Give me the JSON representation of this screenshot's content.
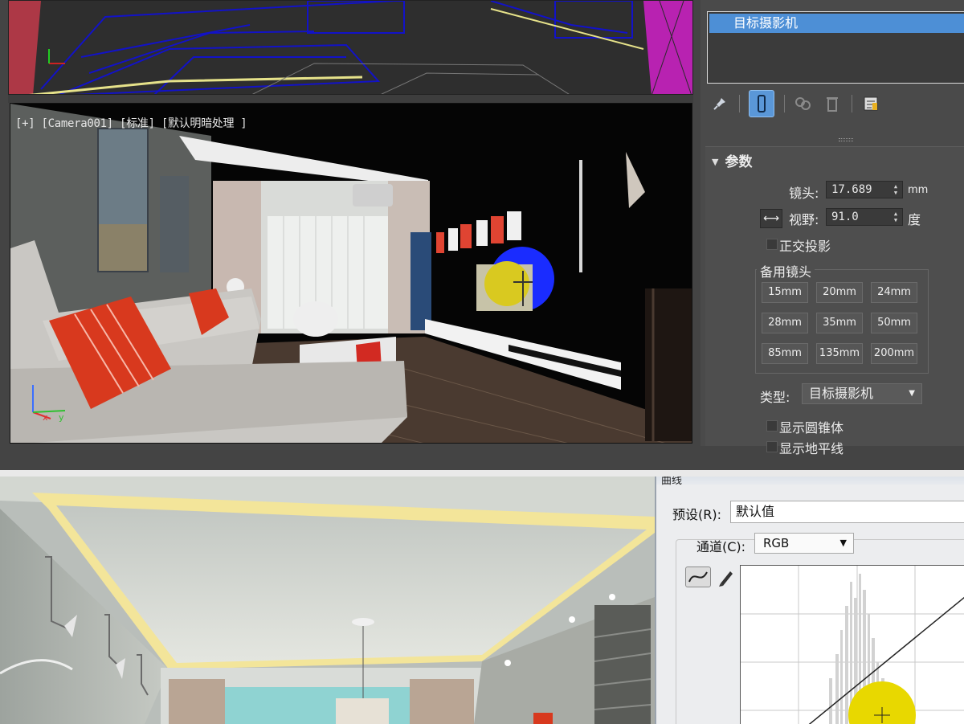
{
  "max": {
    "viewport": {
      "label": "[+] [Camera001] [标准] [默认明暗处理 ]"
    },
    "object_list": {
      "selected_item": "目标摄影机"
    },
    "toolbar": {
      "icons": [
        "pin-icon",
        "modifier-stack-icon",
        "unique-instance-icon",
        "remove-modifier-icon",
        "configure-sets-icon"
      ]
    },
    "parameters": {
      "header": "参数",
      "lens_label": "镜头:",
      "lens_value": "17.689",
      "lens_unit": "mm",
      "fov_toggle": "⟷",
      "fov_label": "视野:",
      "fov_value": "91.0",
      "fov_unit": "度",
      "ortho_label": "正交投影",
      "stock_lenses_label": "备用镜头",
      "stock_lenses": [
        "15mm",
        "20mm",
        "24mm",
        "28mm",
        "35mm",
        "50mm",
        "85mm",
        "135mm",
        "200mm"
      ],
      "type_label": "类型:",
      "type_value": "目标摄影机",
      "show_cone_label": "显示圆锥体",
      "show_horizon_label": "显示地平线"
    }
  },
  "photoshop": {
    "dialog_title": "曲线",
    "preset_label": "预设(R):",
    "preset_value": "默认值",
    "channel_label": "通道(C):",
    "channel_value": "RGB"
  },
  "colors": {
    "selection_blue": "#4d8fd6",
    "max_panel": "#4a4a4a",
    "highlight_yellow": "#e8d800",
    "cushion_red": "#d8391e"
  }
}
